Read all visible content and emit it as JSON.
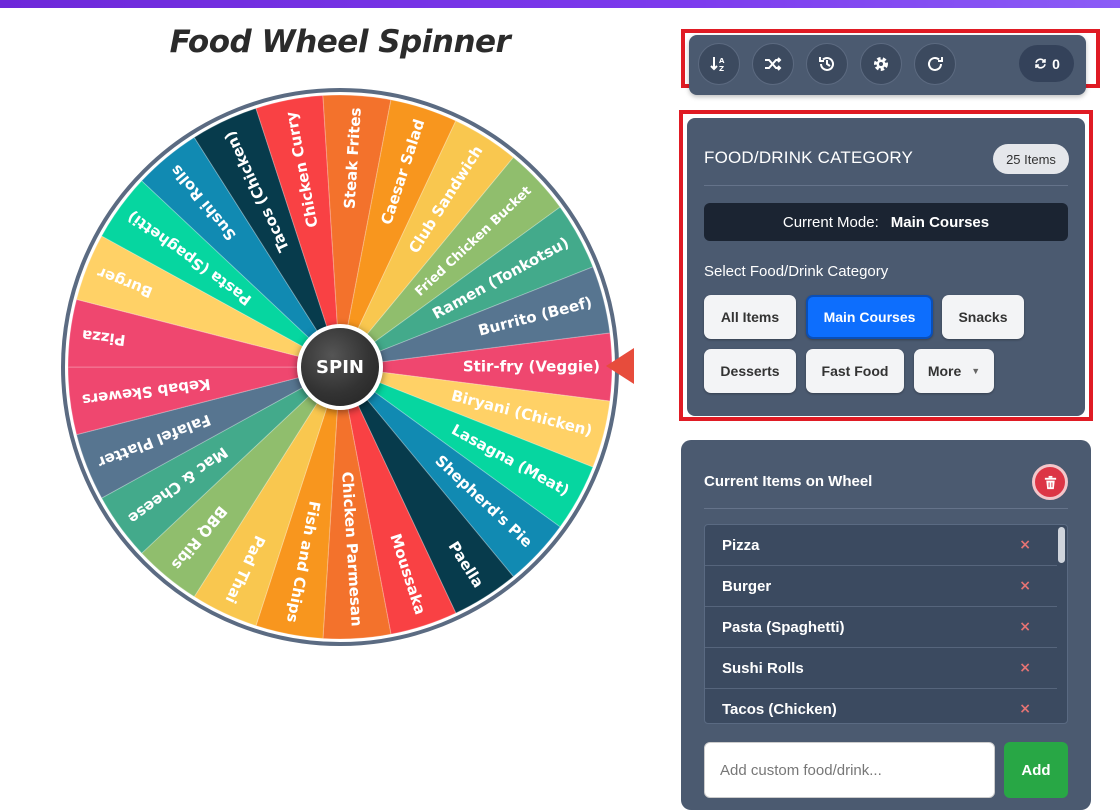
{
  "app": {
    "title": "Food Wheel Spinner"
  },
  "wheel": {
    "spin_label": "SPIN",
    "segments": [
      {
        "label": "Stir-fry (Veggie)",
        "color": "#ef476f"
      },
      {
        "label": "Biryani (Chicken)",
        "color": "#ffd166"
      },
      {
        "label": "Lasagna (Meat)",
        "color": "#06d6a0"
      },
      {
        "label": "Shepherd's Pie",
        "color": "#118ab2"
      },
      {
        "label": "Paella",
        "color": "#073b4c"
      },
      {
        "label": "Moussaka",
        "color": "#f94144"
      },
      {
        "label": "Chicken Parmesan",
        "color": "#f3722c"
      },
      {
        "label": "Fish and Chips",
        "color": "#f8961e"
      },
      {
        "label": "Pad Thai",
        "color": "#f9c74f"
      },
      {
        "label": "BBQ Ribs",
        "color": "#90be6d"
      },
      {
        "label": "Mac & Cheese",
        "color": "#43aa8b"
      },
      {
        "label": "Falafel Platter",
        "color": "#577590"
      },
      {
        "label": "Kebab Skewers",
        "color": "#ef476f"
      },
      {
        "label": "Pizza",
        "color": "#ef476f"
      },
      {
        "label": "Burger",
        "color": "#ffd166"
      },
      {
        "label": "Pasta (Spaghetti)",
        "color": "#06d6a0"
      },
      {
        "label": "Sushi Rolls",
        "color": "#118ab2"
      },
      {
        "label": "Tacos (Chicken)",
        "color": "#073b4c"
      },
      {
        "label": "Chicken Curry",
        "color": "#f94144"
      },
      {
        "label": "Steak Frites",
        "color": "#f3722c"
      },
      {
        "label": "Caesar Salad",
        "color": "#f8961e"
      },
      {
        "label": "Club Sandwich",
        "color": "#f9c74f"
      },
      {
        "label": "Fried Chicken Bucket",
        "color": "#90be6d"
      },
      {
        "label": "Ramen (Tonkotsu)",
        "color": "#43aa8b"
      },
      {
        "label": "Burrito (Beef)",
        "color": "#577590"
      }
    ]
  },
  "toolbar": {
    "buttons": [
      {
        "icon": "sort-icon"
      },
      {
        "icon": "shuffle-icon"
      },
      {
        "icon": "history-icon"
      },
      {
        "icon": "gear-icon"
      },
      {
        "icon": "redo-icon"
      }
    ],
    "spin_count": "0"
  },
  "category": {
    "title": "FOOD/DRINK CATEGORY",
    "count_badge": "25 Items",
    "mode_label": "Current Mode:",
    "mode_value": "Main Courses",
    "select_label": "Select Food/Drink Category",
    "buttons": {
      "all": "All Items",
      "main": "Main Courses",
      "snacks": "Snacks",
      "desserts": "Desserts",
      "fast_food": "Fast Food",
      "more": "More"
    }
  },
  "items": {
    "title": "Current Items on Wheel",
    "list": [
      "Pizza",
      "Burger",
      "Pasta (Spaghetti)",
      "Sushi Rolls",
      "Tacos (Chicken)"
    ],
    "delete_glyph": "×",
    "add_placeholder": "Add custom food/drink...",
    "add_label": "Add"
  },
  "colors": {
    "accent": "#0d6efd",
    "panel": "#4b5a70",
    "danger": "#dc3545",
    "success": "#28a745",
    "pointer": "#e74c3c"
  }
}
